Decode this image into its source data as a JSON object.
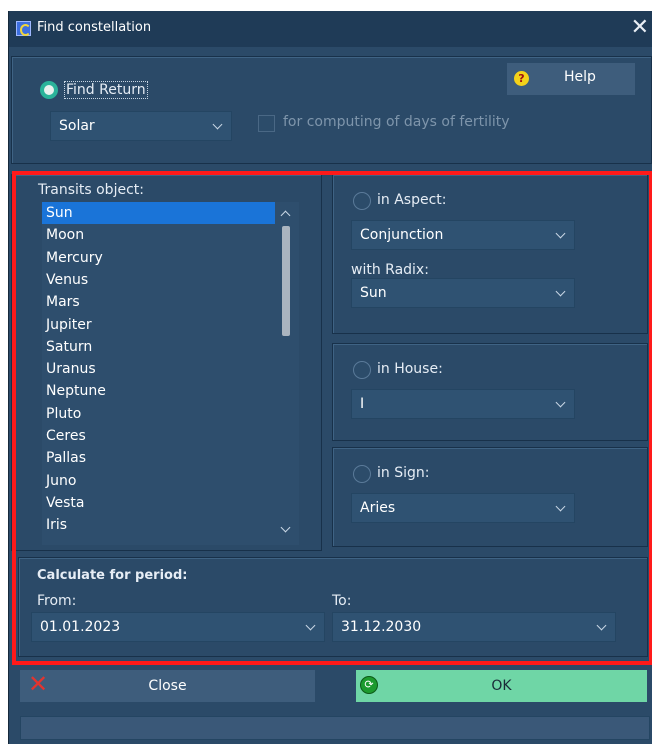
{
  "window": {
    "title": "Find constellation",
    "close_glyph": "✕"
  },
  "find_return": {
    "label": "Find Return",
    "selected": true,
    "help_label": "Help"
  },
  "return_type": {
    "value": "Solar"
  },
  "fertility": {
    "label": "for computing of days of fertility",
    "checked": false,
    "enabled": false
  },
  "transits": {
    "label": "Transits object:",
    "items": [
      "Sun",
      "Moon",
      "Mercury",
      "Venus",
      "Mars",
      "Jupiter",
      "Saturn",
      "Uranus",
      "Neptune",
      "Pluto",
      "Ceres",
      "Pallas",
      "Juno",
      "Vesta",
      "Iris"
    ],
    "selected_index": 0
  },
  "aspect": {
    "label": "in Aspect:",
    "value": "Conjunction",
    "radix_label": "with Radix:",
    "radix_value": "Sun"
  },
  "house": {
    "label": "in House:",
    "value": "I"
  },
  "sign": {
    "label": "in Sign:",
    "value": "Aries"
  },
  "period": {
    "heading": "Calculate for period:",
    "from_label": "From:",
    "from_value": "01.01.2023",
    "to_label": "To:",
    "to_value": "31.12.2030"
  },
  "buttons": {
    "close_label": "Close",
    "ok_label": "OK"
  },
  "colors": {
    "background": "#2b4a68",
    "selection": "#1a74d8",
    "ok_button": "#6fd6a6",
    "highlight_frame": "#ff1a1a"
  }
}
